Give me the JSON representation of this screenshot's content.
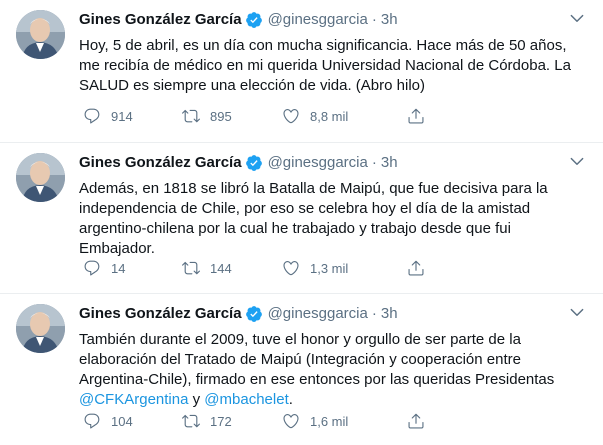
{
  "tweets": [
    {
      "author_name": "Gines González García",
      "handle": "@ginesggarcia",
      "separator": "·",
      "time": "3h",
      "text": "Hoy, 5 de abril, es un día con mucha significancia. Hace más de 50 años, me recibía de médico en mi querida Universidad Nacional de Córdoba. La SALUD es siempre una elección de vida.  (Abro hilo)",
      "replies": "914",
      "retweets": "895",
      "likes": "8,8 mil"
    },
    {
      "author_name": "Gines González García",
      "handle": "@ginesggarcia",
      "separator": "·",
      "time": "3h",
      "text": "Además, en 1818 se libró la Batalla de Maipú, que fue decisiva para la independencia de Chile, por eso se celebra hoy el día de la amistad argentino-chilena por la cual he trabajado y trabajo desde que fui Embajador.",
      "replies": "14",
      "retweets": "144",
      "likes": "1,3 mil"
    },
    {
      "author_name": "Gines González García",
      "handle": "@ginesggarcia",
      "separator": "·",
      "time": "3h",
      "text_main": "También durante el 2009, tuve el honor y orgullo de ser parte de la elaboración del Tratado de Maipú (Integración y cooperación entre Argentina-Chile), firmado en ese entonces por las queridas Presidentas ",
      "mention_1": "@CFKArgentina",
      "text_and": " y ",
      "mention_2": "@mbachelet",
      "text_end": ".",
      "replies": "104",
      "retweets": "172",
      "likes": "1,6 mil"
    }
  ],
  "icons": {
    "avatar": "profile-photo",
    "verified": "verified-badge-icon",
    "more": "more-options-icon",
    "reply": "reply-icon",
    "retweet": "retweet-icon",
    "like": "like-heart-icon",
    "share": "share-icon"
  },
  "colors": {
    "name": "#0f1419",
    "secondary": "#5b7083",
    "link": "#1b95e0",
    "verified": "#1da1f2",
    "divider": "#ebeef0"
  }
}
